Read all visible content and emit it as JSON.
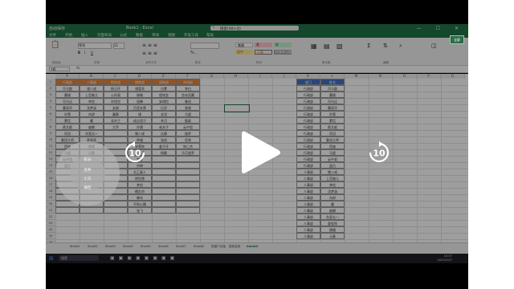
{
  "title_bar": {
    "app": "自动保存",
    "file": "Book1 - Excel",
    "search_placeholder": "搜索(Alt+Q)",
    "window_controls": "— ☐ ✕"
  },
  "menu": [
    "文件",
    "开始",
    "插入",
    "页面布局",
    "公式",
    "数据",
    "审阅",
    "视图",
    "开发工具",
    "帮助"
  ],
  "ribbon": {
    "clipboard": "剪贴板",
    "font": "字体",
    "alignment": "对齐方式",
    "number": "数字",
    "styles_group": "样式",
    "cells": "单元格",
    "editing": "编辑",
    "style_normal": "常规",
    "style_bad": "差",
    "style_good": "好",
    "style_neutral": "适中",
    "style_calc": "计算",
    "style_check": "检查单元格",
    "font_name": "等线",
    "font_size": "11"
  },
  "formula_bar": {
    "name_box": "H5",
    "fx": "fx"
  },
  "columns": [
    "A",
    "B",
    "C",
    "D",
    "E",
    "F",
    "G",
    "H",
    "I",
    "J",
    "K",
    "L",
    "M",
    "N",
    "O",
    "P",
    "Q"
  ],
  "table_left": {
    "headers": [
      "行政部",
      "人事部",
      "财务部",
      "销售部",
      "采购部",
      "市场部"
    ],
    "rows": [
      [
        "司马懿",
        "诸八戒",
        "杨玉环",
        "诸葛亮",
        "吕蒙",
        "李白"
      ],
      [
        "曹操",
        "上官婉儿",
        "公孙离",
        "周瑜",
        "程咬金",
        "宫本武藏"
      ],
      [
        "司马迁",
        "李信",
        "孙悟空",
        "貂蝉",
        "安琪拉",
        "鲁班"
      ],
      [
        "曹丽华",
        "沈梦溪",
        "女娲",
        "百里玄策",
        "后羿",
        "香香"
      ],
      [
        "孙策",
        "刘邦",
        "廉颇",
        "镜",
        "关羽",
        "马超"
      ],
      [
        "蒙恬",
        "曜",
        "花木兰",
        "成吉思汗",
        "芈月",
        "甄姬"
      ],
      [
        "蔡文姬",
        "扁鹊",
        "大乔",
        "孙膑",
        "老夫子",
        "云中君"
      ],
      [
        "项羽",
        "东皇太一",
        "",
        "猪八戒",
        "达摩",
        "伽罗"
      ],
      [
        "鲁班大师",
        "夏侯惇",
        "",
        "钟馗",
        "张良",
        "狂铁"
      ],
      [
        "西施",
        "嫦娥",
        "",
        "米莱狄",
        "姜子牙",
        "狄仁杰"
      ],
      [
        "马超",
        "元歌",
        "",
        "鬼谷子",
        "杨戬",
        "马可波罗"
      ],
      [
        "云中君",
        "",
        "",
        "弈星",
        "",
        ""
      ],
      [
        "盘古",
        "",
        "",
        "刘禅",
        "",
        ""
      ],
      [
        "",
        "",
        "",
        "太乙真人",
        "",
        ""
      ],
      [
        "",
        "",
        "",
        "明世隐",
        "",
        ""
      ],
      [
        "",
        "",
        "",
        "李信",
        "",
        ""
      ],
      [
        "",
        "",
        "",
        "橘右京",
        "",
        ""
      ],
      [
        "",
        "",
        "",
        "哪吒",
        "",
        ""
      ],
      [
        "",
        "",
        "",
        "不知火舞",
        "",
        ""
      ],
      [
        "",
        "",
        "",
        "张飞",
        "",
        ""
      ]
    ]
  },
  "table_right": {
    "headers": [
      "部门",
      "姓名"
    ],
    "rows": [
      [
        "行政部",
        "司马懿"
      ],
      [
        "行政部",
        "曹操"
      ],
      [
        "行政部",
        "司马迁"
      ],
      [
        "行政部",
        "曹丽华"
      ],
      [
        "行政部",
        "孙策"
      ],
      [
        "行政部",
        "蒙恬"
      ],
      [
        "行政部",
        "蔡文姬"
      ],
      [
        "行政部",
        "项羽"
      ],
      [
        "行政部",
        "鲁班大师"
      ],
      [
        "行政部",
        "西施"
      ],
      [
        "行政部",
        "马超"
      ],
      [
        "行政部",
        "云中君"
      ],
      [
        "行政部",
        "盘古"
      ],
      [
        "人事部",
        "猪八戒"
      ],
      [
        "人事部",
        "上官婉儿"
      ],
      [
        "人事部",
        "李信"
      ],
      [
        "人事部",
        "沈梦溪"
      ],
      [
        "人事部",
        "刘邦"
      ],
      [
        "人事部",
        "曜"
      ],
      [
        "人事部",
        "扁鹊"
      ],
      [
        "人事部",
        "东皇太一"
      ],
      [
        "人事部",
        "夏侯惇"
      ],
      [
        "人事部",
        "嫦娥"
      ],
      [
        "人事部",
        "元歌"
      ]
    ]
  },
  "sheet_tabs": [
    "Sheet1",
    "Sheet2",
    "Sheet3",
    "Sheet4",
    "Sheet5",
    "Sheet6",
    "Sheet7",
    "Sheet8",
    "按部门分组",
    "按姓名排",
    "Sheet9"
  ],
  "circle_menu": {
    "item1": "拆分",
    "item2": "合并",
    "item3": "小方",
    "item4": "填空"
  },
  "skip_back": "10",
  "skip_forward": "10",
  "corner_badge": "全屏",
  "taskbar": {
    "search": "搜索",
    "time": "10:57",
    "date": "2023/10/7"
  }
}
